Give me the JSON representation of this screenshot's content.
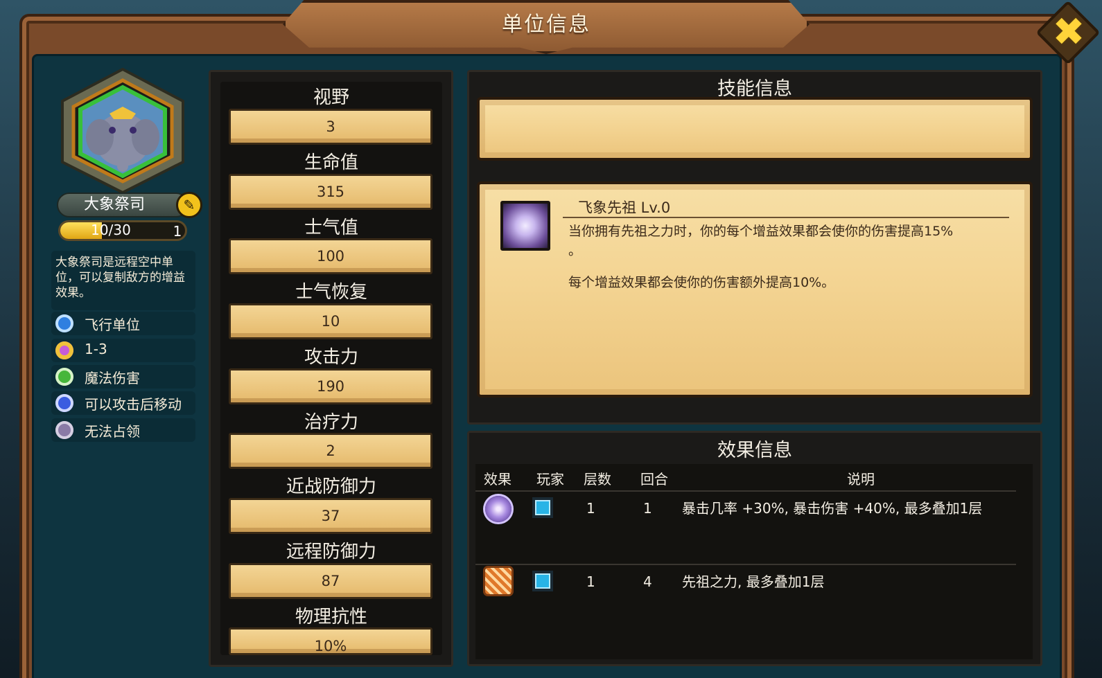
{
  "title": "单位信息",
  "close_icon": "close-x-icon",
  "unit": {
    "name": "大象祭司",
    "xp_text": "10/30",
    "xp_fraction": 0.333,
    "level": "1",
    "description": "大象祭司是远程空中单位，可以复制敌方的增益效果。",
    "traits": [
      {
        "icon": "flying-unit-icon",
        "label": "飞行单位",
        "color": "#2f7fe0"
      },
      {
        "icon": "range-icon",
        "label": "1-3",
        "color": "#c65cd8"
      },
      {
        "icon": "magic-damage-icon",
        "label": "魔法伤害",
        "color": "#46b63a"
      },
      {
        "icon": "move-after-attack-icon",
        "label": "可以攻击后移动",
        "color": "#3a5ce0"
      },
      {
        "icon": "cannot-capture-icon",
        "label": "无法占领",
        "color": "#8a7aa6"
      }
    ]
  },
  "stats": [
    {
      "label": "视野",
      "value": "3"
    },
    {
      "label": "生命值",
      "value": "315"
    },
    {
      "label": "士气值",
      "value": "100"
    },
    {
      "label": "士气恢复",
      "value": "10"
    },
    {
      "label": "攻击力",
      "value": "190"
    },
    {
      "label": "治疗力",
      "value": "2"
    },
    {
      "label": "近战防御力",
      "value": "37"
    },
    {
      "label": "远程防御力",
      "value": "87"
    },
    {
      "label": "物理抗性",
      "value": "10%"
    }
  ],
  "skill": {
    "panel_title": "技能信息",
    "name": "飞象先祖 Lv.0",
    "desc_line1": "当你拥有先祖之力时，你的每个增益效果都会使你的伤害提高15%",
    "desc_line2": "。",
    "desc_line3": "每个增益效果都会使你的伤害额外提高10%。"
  },
  "effects": {
    "panel_title": "效果信息",
    "headers": {
      "effect": "效果",
      "player": "玩家",
      "stacks": "层数",
      "rounds": "回合",
      "desc": "说明"
    },
    "rows": [
      {
        "icon": "crit-swirl-icon",
        "stacks": "1",
        "rounds": "1",
        "desc": "暴击几率 +30%, 暴击伤害 +40%, 最多叠加1层"
      },
      {
        "icon": "ancestor-power-icon",
        "stacks": "1",
        "rounds": "4",
        "desc": "先祖之力, 最多叠加1层"
      }
    ]
  }
}
